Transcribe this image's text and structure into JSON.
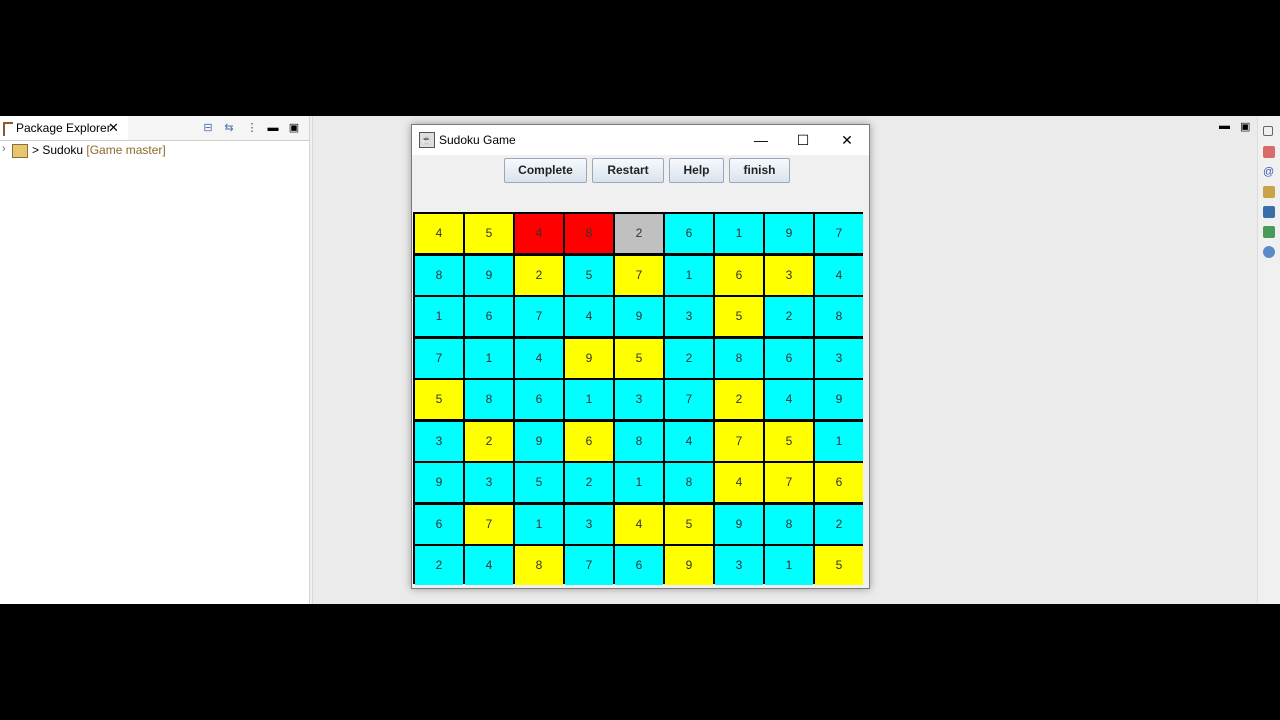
{
  "ide": {
    "package_explorer_label": "Package Explorer",
    "close_glyph": "✕",
    "project": {
      "name": "> Sudoku",
      "branch": "[Game master]"
    },
    "toolbar_icons": [
      "collapse-all-icon",
      "link-with-editor-icon",
      "view-menu-icon",
      "minimize-icon",
      "maximize-icon"
    ]
  },
  "window": {
    "title": "Sudoku Game",
    "minimize_glyph": "—",
    "maximize_glyph": "☐",
    "close_glyph": "✕"
  },
  "buttons": {
    "complete": "Complete",
    "restart": "Restart",
    "help": "Help",
    "finish": "finish"
  },
  "colors": {
    "Y": "#ffff00",
    "C": "#00ffff",
    "R": "#ff0000",
    "G": "#c0c0c0"
  },
  "board": {
    "values": [
      [
        "4",
        "5",
        "4",
        "8",
        "2",
        "6",
        "1",
        "9",
        "7"
      ],
      [
        "8",
        "9",
        "2",
        "5",
        "7",
        "1",
        "6",
        "3",
        "4"
      ],
      [
        "1",
        "6",
        "7",
        "4",
        "9",
        "3",
        "5",
        "2",
        "8"
      ],
      [
        "7",
        "1",
        "4",
        "9",
        "5",
        "2",
        "8",
        "6",
        "3"
      ],
      [
        "5",
        "8",
        "6",
        "1",
        "3",
        "7",
        "2",
        "4",
        "9"
      ],
      [
        "3",
        "2",
        "9",
        "6",
        "8",
        "4",
        "7",
        "5",
        "1"
      ],
      [
        "9",
        "3",
        "5",
        "2",
        "1",
        "8",
        "4",
        "7",
        "6"
      ],
      [
        "6",
        "7",
        "1",
        "3",
        "4",
        "5",
        "9",
        "8",
        "2"
      ],
      [
        "2",
        "4",
        "8",
        "7",
        "6",
        "9",
        "3",
        "1",
        "5"
      ]
    ],
    "cell_colors": [
      [
        "Y",
        "Y",
        "R",
        "R",
        "G",
        "C",
        "C",
        "C",
        "C"
      ],
      [
        "C",
        "C",
        "Y",
        "C",
        "Y",
        "C",
        "Y",
        "Y",
        "C"
      ],
      [
        "C",
        "C",
        "C",
        "C",
        "C",
        "C",
        "Y",
        "C",
        "C"
      ],
      [
        "C",
        "C",
        "C",
        "Y",
        "Y",
        "C",
        "C",
        "C",
        "C"
      ],
      [
        "Y",
        "C",
        "C",
        "C",
        "C",
        "C",
        "Y",
        "C",
        "C"
      ],
      [
        "C",
        "Y",
        "C",
        "Y",
        "C",
        "C",
        "Y",
        "Y",
        "C"
      ],
      [
        "C",
        "C",
        "C",
        "C",
        "C",
        "C",
        "Y",
        "Y",
        "Y"
      ],
      [
        "C",
        "Y",
        "C",
        "C",
        "Y",
        "Y",
        "C",
        "C",
        "C"
      ],
      [
        "C",
        "C",
        "Y",
        "C",
        "C",
        "Y",
        "C",
        "C",
        "Y"
      ]
    ]
  }
}
